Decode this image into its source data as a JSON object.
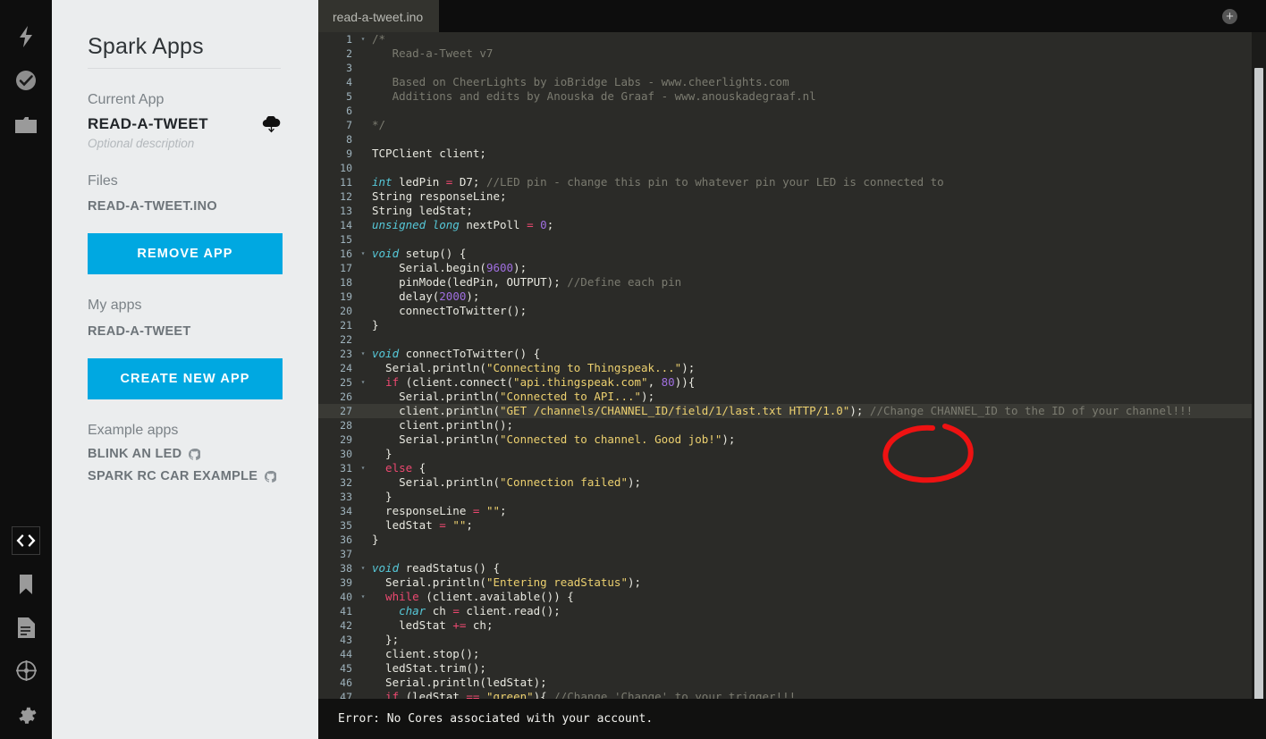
{
  "rail": {
    "top_icons": [
      {
        "name": "lightning-icon",
        "label": "flash"
      },
      {
        "name": "check-circle-icon",
        "label": "verify"
      },
      {
        "name": "folder-icon",
        "label": "files"
      }
    ],
    "bottom_icons": [
      {
        "name": "code-brackets-icon",
        "label": "code",
        "active": true
      },
      {
        "name": "bookmark-icon",
        "label": "bookmark",
        "active": false
      },
      {
        "name": "document-icon",
        "label": "docs",
        "active": false
      },
      {
        "name": "target-icon",
        "label": "cores",
        "active": false
      },
      {
        "name": "gear-icon",
        "label": "settings",
        "active": false
      }
    ]
  },
  "sidebar": {
    "title": "Spark Apps",
    "current_app_label": "Current App",
    "current_app_name": "READ-A-TWEET",
    "current_app_description": "Optional description",
    "files_label": "Files",
    "file_name": "READ-A-TWEET.INO",
    "remove_app_button": "REMOVE APP",
    "my_apps_label": "My apps",
    "my_apps": [
      "READ-A-TWEET"
    ],
    "create_new_app_button": "CREATE NEW APP",
    "example_apps_label": "Example apps",
    "example_apps": [
      "BLINK AN LED",
      "SPARK RC CAR EXAMPLE"
    ]
  },
  "editor": {
    "tab_label": "read-a-tweet.ino",
    "add_tab_icon": "+",
    "highlighted_line": 27,
    "annotation": {
      "shape": "hand-drawn-ellipse",
      "color": "#ee1212",
      "targets": "CHANNEL_ID"
    },
    "lines": [
      {
        "n": 1,
        "fold": true,
        "tokens": [
          [
            "cmt",
            "/*"
          ]
        ]
      },
      {
        "n": 2,
        "fold": false,
        "tokens": [
          [
            "cmt",
            "   Read-a-Tweet v7"
          ]
        ]
      },
      {
        "n": 3,
        "fold": false,
        "tokens": [
          [
            "cmt",
            ""
          ]
        ]
      },
      {
        "n": 4,
        "fold": false,
        "tokens": [
          [
            "cmt",
            "   Based on CheerLights by ioBridge Labs - www.cheerlights.com"
          ]
        ]
      },
      {
        "n": 5,
        "fold": false,
        "tokens": [
          [
            "cmt",
            "   Additions and edits by Anouska de Graaf - www.anouskadegraaf.nl"
          ]
        ]
      },
      {
        "n": 6,
        "fold": false,
        "tokens": [
          [
            "cmt",
            ""
          ]
        ]
      },
      {
        "n": 7,
        "fold": false,
        "tokens": [
          [
            "cmt",
            "*/"
          ]
        ]
      },
      {
        "n": 8,
        "fold": false,
        "tokens": [
          [
            "pln",
            ""
          ]
        ]
      },
      {
        "n": 9,
        "fold": false,
        "tokens": [
          [
            "pln",
            "TCPClient client;"
          ]
        ]
      },
      {
        "n": 10,
        "fold": false,
        "tokens": [
          [
            "pln",
            ""
          ]
        ]
      },
      {
        "n": 11,
        "fold": false,
        "tokens": [
          [
            "kw",
            "int"
          ],
          [
            "pln",
            " ledPin "
          ],
          [
            "op",
            "="
          ],
          [
            "pln",
            " D7; "
          ],
          [
            "cmt",
            "//LED pin - change this pin to whatever pin your LED is connected to"
          ]
        ]
      },
      {
        "n": 12,
        "fold": false,
        "tokens": [
          [
            "pln",
            "String responseLine;"
          ]
        ]
      },
      {
        "n": 13,
        "fold": false,
        "tokens": [
          [
            "pln",
            "String ledStat;"
          ]
        ]
      },
      {
        "n": 14,
        "fold": false,
        "tokens": [
          [
            "kw",
            "unsigned long"
          ],
          [
            "pln",
            " nextPoll "
          ],
          [
            "op",
            "="
          ],
          [
            "pln",
            " "
          ],
          [
            "num",
            "0"
          ],
          [
            "pln",
            ";"
          ]
        ]
      },
      {
        "n": 15,
        "fold": false,
        "tokens": [
          [
            "pln",
            ""
          ]
        ]
      },
      {
        "n": 16,
        "fold": true,
        "tokens": [
          [
            "kw",
            "void"
          ],
          [
            "pln",
            " setup() {"
          ]
        ]
      },
      {
        "n": 17,
        "fold": false,
        "tokens": [
          [
            "pln",
            "    Serial.begin("
          ],
          [
            "num",
            "9600"
          ],
          [
            "pln",
            ");"
          ]
        ]
      },
      {
        "n": 18,
        "fold": false,
        "tokens": [
          [
            "pln",
            "    pinMode(ledPin, OUTPUT); "
          ],
          [
            "cmt",
            "//Define each pin"
          ]
        ]
      },
      {
        "n": 19,
        "fold": false,
        "tokens": [
          [
            "pln",
            "    delay("
          ],
          [
            "num",
            "2000"
          ],
          [
            "pln",
            ");"
          ]
        ]
      },
      {
        "n": 20,
        "fold": false,
        "tokens": [
          [
            "pln",
            "    connectToTwitter();"
          ]
        ]
      },
      {
        "n": 21,
        "fold": false,
        "tokens": [
          [
            "pln",
            "}"
          ]
        ]
      },
      {
        "n": 22,
        "fold": false,
        "tokens": [
          [
            "pln",
            ""
          ]
        ]
      },
      {
        "n": 23,
        "fold": true,
        "tokens": [
          [
            "kw",
            "void"
          ],
          [
            "pln",
            " connectToTwitter() {"
          ]
        ]
      },
      {
        "n": 24,
        "fold": false,
        "tokens": [
          [
            "pln",
            "  Serial.println("
          ],
          [
            "str",
            "\"Connecting to Thingspeak...\""
          ],
          [
            "pln",
            ");"
          ]
        ]
      },
      {
        "n": 25,
        "fold": true,
        "tokens": [
          [
            "ctl",
            "  if"
          ],
          [
            "pln",
            " (client.connect("
          ],
          [
            "str",
            "\"api.thingspeak.com\""
          ],
          [
            "pln",
            ", "
          ],
          [
            "num",
            "80"
          ],
          [
            "pln",
            ")){"
          ]
        ]
      },
      {
        "n": 26,
        "fold": false,
        "tokens": [
          [
            "pln",
            "    Serial.println("
          ],
          [
            "str",
            "\"Connected to API...\""
          ],
          [
            "pln",
            ");"
          ]
        ]
      },
      {
        "n": 27,
        "fold": false,
        "tokens": [
          [
            "pln",
            "    client.println("
          ],
          [
            "str",
            "\"GET /channels/CHANNEL_ID/field/1/last.txt HTTP/1.0\""
          ],
          [
            "pln",
            "); "
          ],
          [
            "cmt",
            "//Change CHANNEL_ID to the ID of your channel!!!"
          ]
        ]
      },
      {
        "n": 28,
        "fold": false,
        "tokens": [
          [
            "pln",
            "    client.println();"
          ]
        ]
      },
      {
        "n": 29,
        "fold": false,
        "tokens": [
          [
            "pln",
            "    Serial.println("
          ],
          [
            "str",
            "\"Connected to channel. Good job!\""
          ],
          [
            "pln",
            ");"
          ]
        ]
      },
      {
        "n": 30,
        "fold": false,
        "tokens": [
          [
            "pln",
            "  }"
          ]
        ]
      },
      {
        "n": 31,
        "fold": true,
        "tokens": [
          [
            "ctl",
            "  else"
          ],
          [
            "pln",
            " {"
          ]
        ]
      },
      {
        "n": 32,
        "fold": false,
        "tokens": [
          [
            "pln",
            "    Serial.println("
          ],
          [
            "str",
            "\"Connection failed\""
          ],
          [
            "pln",
            ");"
          ]
        ]
      },
      {
        "n": 33,
        "fold": false,
        "tokens": [
          [
            "pln",
            "  }"
          ]
        ]
      },
      {
        "n": 34,
        "fold": false,
        "tokens": [
          [
            "pln",
            "  responseLine "
          ],
          [
            "op",
            "="
          ],
          [
            "pln",
            " "
          ],
          [
            "str",
            "\"\""
          ],
          [
            "pln",
            ";"
          ]
        ]
      },
      {
        "n": 35,
        "fold": false,
        "tokens": [
          [
            "pln",
            "  ledStat "
          ],
          [
            "op",
            "="
          ],
          [
            "pln",
            " "
          ],
          [
            "str",
            "\"\""
          ],
          [
            "pln",
            ";"
          ]
        ]
      },
      {
        "n": 36,
        "fold": false,
        "tokens": [
          [
            "pln",
            "}"
          ]
        ]
      },
      {
        "n": 37,
        "fold": false,
        "tokens": [
          [
            "pln",
            ""
          ]
        ]
      },
      {
        "n": 38,
        "fold": true,
        "tokens": [
          [
            "kw",
            "void"
          ],
          [
            "pln",
            " readStatus() {"
          ]
        ]
      },
      {
        "n": 39,
        "fold": false,
        "tokens": [
          [
            "pln",
            "  Serial.println("
          ],
          [
            "str",
            "\"Entering readStatus\""
          ],
          [
            "pln",
            ");"
          ]
        ]
      },
      {
        "n": 40,
        "fold": true,
        "tokens": [
          [
            "ctl",
            "  while"
          ],
          [
            "pln",
            " (client.available()) {"
          ]
        ]
      },
      {
        "n": 41,
        "fold": false,
        "tokens": [
          [
            "kw",
            "    char"
          ],
          [
            "pln",
            " ch "
          ],
          [
            "op",
            "="
          ],
          [
            "pln",
            " client.read();"
          ]
        ]
      },
      {
        "n": 42,
        "fold": false,
        "tokens": [
          [
            "pln",
            "    ledStat "
          ],
          [
            "op",
            "+="
          ],
          [
            "pln",
            " ch;"
          ]
        ]
      },
      {
        "n": 43,
        "fold": false,
        "tokens": [
          [
            "pln",
            "  };"
          ]
        ]
      },
      {
        "n": 44,
        "fold": false,
        "tokens": [
          [
            "pln",
            "  client.stop();"
          ]
        ]
      },
      {
        "n": 45,
        "fold": false,
        "tokens": [
          [
            "pln",
            "  ledStat.trim();"
          ]
        ]
      },
      {
        "n": 46,
        "fold": false,
        "tokens": [
          [
            "pln",
            "  Serial.println(ledStat);"
          ]
        ]
      },
      {
        "n": 47,
        "fold": false,
        "tokens": [
          [
            "ctl",
            "  if"
          ],
          [
            "pln",
            " (ledStat "
          ],
          [
            "op",
            "=="
          ],
          [
            "pln",
            " "
          ],
          [
            "str",
            "\"green\""
          ],
          [
            "pln",
            "){ "
          ],
          [
            "cmt",
            "//Change 'Change' to your trigger!!!"
          ]
        ]
      }
    ]
  },
  "status": {
    "message": "Error: No Cores associated with your account."
  },
  "colors": {
    "accent": "#00a8e1",
    "sidebar_bg": "#ebedee",
    "rail_bg": "#0e0e0e",
    "editor_bg": "#2b2b28",
    "annotation_red": "#ee1212"
  }
}
